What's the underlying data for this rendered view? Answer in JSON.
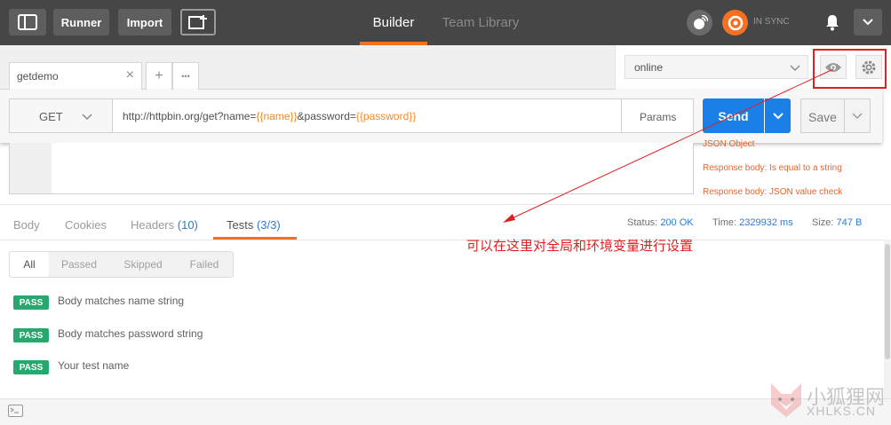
{
  "topbar": {
    "runner_label": "Runner",
    "import_label": "Import",
    "builder_tab": "Builder",
    "team_library_tab": "Team Library",
    "sync_status": "IN SYNC"
  },
  "request_tabs": {
    "active_tab": "getdemo",
    "close_glyph": "×",
    "add_glyph": "+",
    "more_glyph": "•••"
  },
  "environment": {
    "selected": "online"
  },
  "request": {
    "method": "GET",
    "url_prefix": "http://httpbin.org/get?name=",
    "var1": "{{name}}",
    "url_mid": "&password=",
    "var2": "{{password}}",
    "params_label": "Params",
    "send_label": "Send",
    "save_label": "Save"
  },
  "snippets": [
    "JSON Object",
    "Response body: Is equal to a string",
    "Response body: JSON value check"
  ],
  "response_tabs": {
    "body": "Body",
    "cookies": "Cookies",
    "headers": "Headers",
    "headers_count": "(10)",
    "tests": "Tests",
    "tests_count": "(3/3)"
  },
  "response_meta": {
    "status_label": "Status:",
    "status_value": "200 OK",
    "time_label": "Time:",
    "time_value": "2329932 ms",
    "size_label": "Size:",
    "size_value": "747 B"
  },
  "annotation": {
    "text": "可以在这里对全局和环境变量进行设置",
    "color": "#e02020"
  },
  "filters": [
    "All",
    "Passed",
    "Skipped",
    "Failed"
  ],
  "tests": [
    {
      "badge": "PASS",
      "name": "Body matches name string"
    },
    {
      "badge": "PASS",
      "name": "Body matches password string"
    },
    {
      "badge": "PASS",
      "name": "Your test name"
    }
  ],
  "watermark": {
    "cn": "小狐狸网",
    "en": "XHLKS.CN"
  },
  "colors": {
    "accent": "#f47023",
    "send_blue": "#1a7fe6",
    "pass_green": "#26a86f",
    "topbar_bg": "#464646"
  }
}
